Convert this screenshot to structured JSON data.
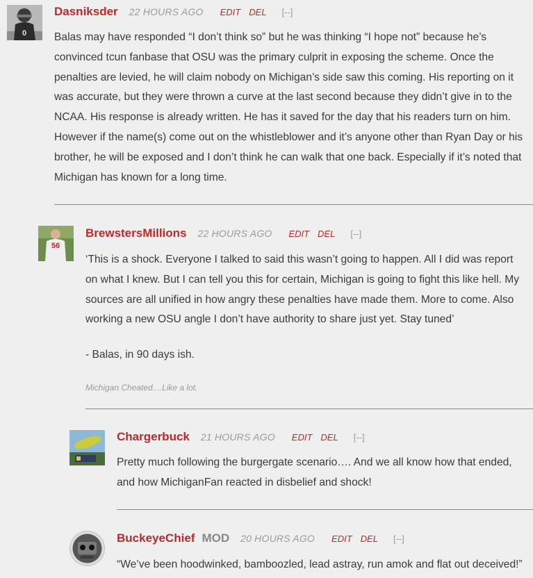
{
  "actions": {
    "edit": "EDIT",
    "del": "DEL",
    "collapse": "[--]"
  },
  "comments": [
    {
      "username": "Dasniksder",
      "time": "22 HOURS AGO",
      "body": "Balas may have responded “I don’t think so” but he was thinking “I hope not” because he’s convinced tcun fanbase that  OSU was the primary culprit in exposing the scheme. Once the penalties are levied, he will claim nobody on Michigan’s side saw this coming. His reporting on it was accurate, but they were thrown a curve at the last second because they didn’t give in to the NCAA. His response is already written. He has it saved for the day that his readers turn on him. However if the name(s) come out on the whistleblower and it’s anyone other than Ryan Day or his brother, he will be exposed and I don’t think he can walk that one back. Especially if it’s noted that Michigan has known for a long time."
    },
    {
      "username": "BrewstersMillions",
      "time": "22 HOURS AGO",
      "body_p1": "‘This is a shock. Everyone I talked to said this wasn’t going to happen. All I did was report on what I knew. But I can tell you this for certain, Michigan is going to fight this like hell. My sources are all unified in how angry these penalties have made them. More to come. Also working a new OSU angle I don’t have authority to share just yet. Stay tuned’",
      "body_p2": "- Balas, in 90 days ish.",
      "signature": "Michigan Cheated....Like a lot."
    },
    {
      "username": "Chargerbuck",
      "time": "21 HOURS AGO",
      "body": "Pretty much following the burgergate scenario…. And we all know how that ended, and how MichiganFan reacted in disbelief and shock!"
    },
    {
      "username": "BuckeyeChief",
      "mod_badge": "MOD",
      "time": "20 HOURS AGO",
      "body": "“We’ve been hoodwinked, bamboozled, lead astray, run amok and flat out deceived!”"
    }
  ]
}
